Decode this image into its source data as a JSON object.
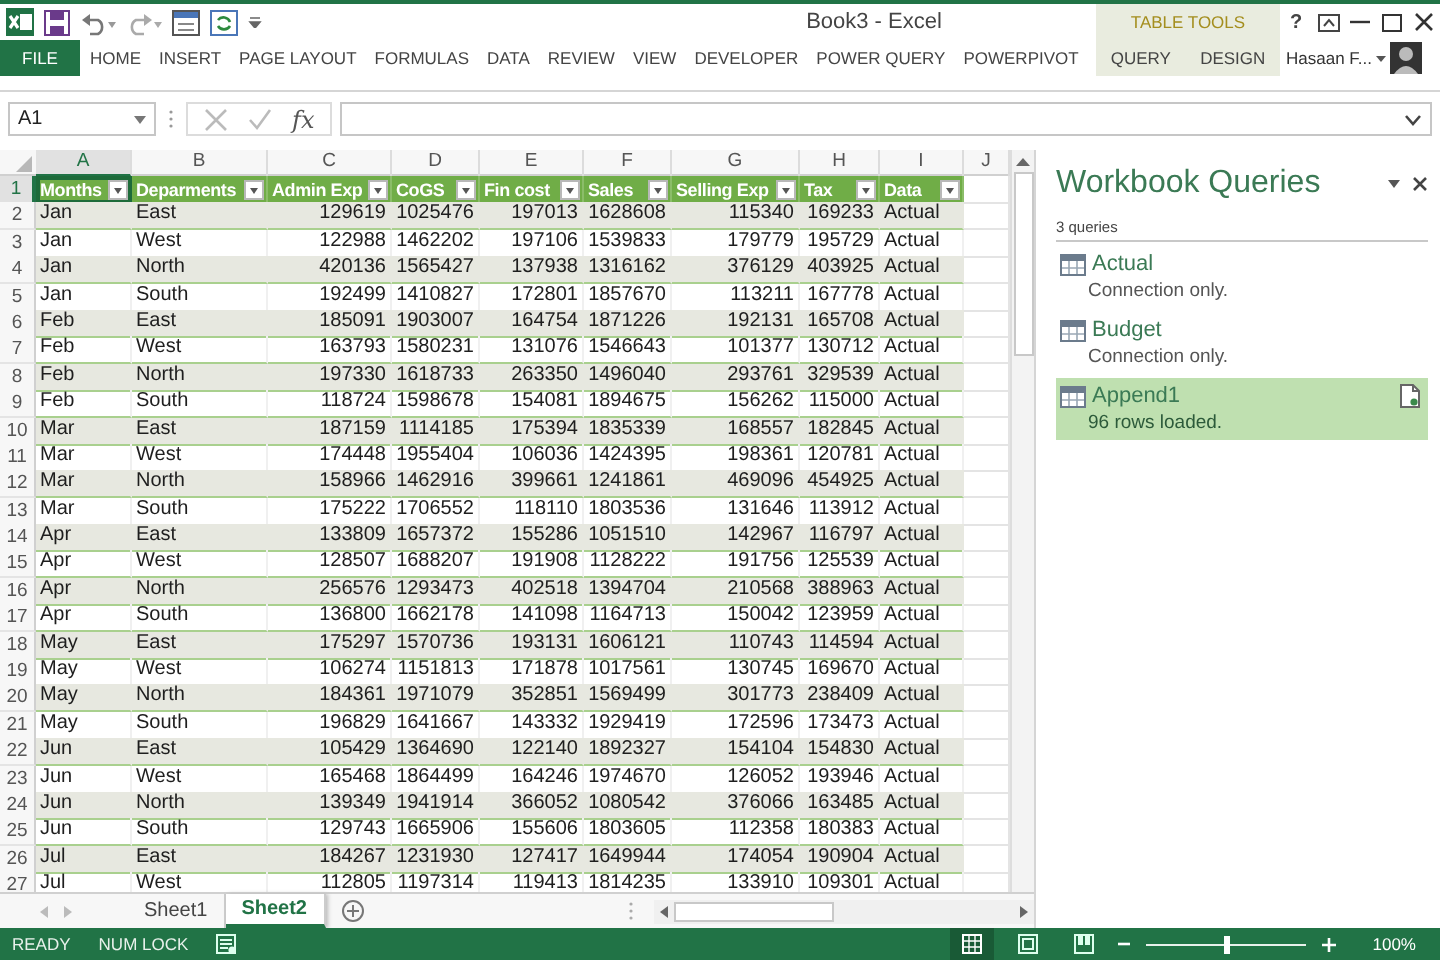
{
  "window": {
    "title": "Book3 - Excel",
    "help": "?"
  },
  "ribbon": {
    "contextual_group": "TABLE TOOLS",
    "user": "Hasaan F...",
    "tabs": [
      {
        "label": "FILE",
        "kind": "file",
        "selected": false
      },
      {
        "label": "HOME",
        "kind": "main",
        "selected": false
      },
      {
        "label": "INSERT",
        "kind": "main",
        "selected": false
      },
      {
        "label": "PAGE LAYOUT",
        "kind": "main",
        "selected": false
      },
      {
        "label": "FORMULAS",
        "kind": "main",
        "selected": false
      },
      {
        "label": "DATA",
        "kind": "main",
        "selected": false
      },
      {
        "label": "REVIEW",
        "kind": "main",
        "selected": false
      },
      {
        "label": "VIEW",
        "kind": "main",
        "selected": false
      },
      {
        "label": "DEVELOPER",
        "kind": "main",
        "selected": false
      },
      {
        "label": "POWER QUERY",
        "kind": "main",
        "selected": false
      },
      {
        "label": "POWERPIVOT",
        "kind": "main",
        "selected": false
      },
      {
        "label": "QUERY",
        "kind": "contextual",
        "selected": false
      },
      {
        "label": "DESIGN",
        "kind": "contextual",
        "selected": false
      }
    ]
  },
  "formula_bar": {
    "name_box": "A1",
    "function_label": "fx"
  },
  "sheet": {
    "columns": [
      {
        "letter": "A",
        "kind": "text",
        "selected": true
      },
      {
        "letter": "B",
        "kind": "text",
        "selected": false
      },
      {
        "letter": "C",
        "kind": "number",
        "selected": false
      },
      {
        "letter": "D",
        "kind": "number",
        "selected": false
      },
      {
        "letter": "E",
        "kind": "number",
        "selected": false
      },
      {
        "letter": "F",
        "kind": "number",
        "selected": false
      },
      {
        "letter": "G",
        "kind": "number",
        "selected": false
      },
      {
        "letter": "H",
        "kind": "number",
        "selected": false
      },
      {
        "letter": "I",
        "kind": "text",
        "selected": false
      },
      {
        "letter": "J",
        "selected": false
      }
    ],
    "header_row": {
      "row_number": "1",
      "selected": true,
      "cells": [
        "Months",
        "Deparments",
        "Admin Exp",
        "CoGS",
        "Fin cost",
        "Sales",
        "Selling Exp",
        "Tax",
        "Data"
      ]
    },
    "rows": [
      {
        "row_number": "2",
        "selected": false,
        "cells": [
          "Jan",
          "East",
          "129619",
          "1025476",
          "197013",
          "1628608",
          "115340",
          "169233",
          "Actual"
        ]
      },
      {
        "row_number": "3",
        "selected": false,
        "cells": [
          "Jan",
          "West",
          "122988",
          "1462202",
          "197106",
          "1539833",
          "179779",
          "195729",
          "Actual"
        ]
      },
      {
        "row_number": "4",
        "selected": false,
        "cells": [
          "Jan",
          "North",
          "420136",
          "1565427",
          "137938",
          "1316162",
          "376129",
          "403925",
          "Actual"
        ]
      },
      {
        "row_number": "5",
        "selected": false,
        "cells": [
          "Jan",
          "South",
          "192499",
          "1410827",
          "172801",
          "1857670",
          "113211",
          "167778",
          "Actual"
        ]
      },
      {
        "row_number": "6",
        "selected": false,
        "cells": [
          "Feb",
          "East",
          "185091",
          "1903007",
          "164754",
          "1871226",
          "192131",
          "165708",
          "Actual"
        ]
      },
      {
        "row_number": "7",
        "selected": false,
        "cells": [
          "Feb",
          "West",
          "163793",
          "1580231",
          "131076",
          "1546643",
          "101377",
          "130712",
          "Actual"
        ]
      },
      {
        "row_number": "8",
        "selected": false,
        "cells": [
          "Feb",
          "North",
          "197330",
          "1618733",
          "263350",
          "1496040",
          "293761",
          "329539",
          "Actual"
        ]
      },
      {
        "row_number": "9",
        "selected": false,
        "cells": [
          "Feb",
          "South",
          "118724",
          "1598678",
          "154081",
          "1894675",
          "156262",
          "115000",
          "Actual"
        ]
      },
      {
        "row_number": "10",
        "selected": false,
        "cells": [
          "Mar",
          "East",
          "187159",
          "1114185",
          "175394",
          "1835339",
          "168557",
          "182845",
          "Actual"
        ]
      },
      {
        "row_number": "11",
        "selected": false,
        "cells": [
          "Mar",
          "West",
          "174448",
          "1955404",
          "106036",
          "1424395",
          "198361",
          "120781",
          "Actual"
        ]
      },
      {
        "row_number": "12",
        "selected": false,
        "cells": [
          "Mar",
          "North",
          "158966",
          "1462916",
          "399661",
          "1241861",
          "469096",
          "454925",
          "Actual"
        ]
      },
      {
        "row_number": "13",
        "selected": false,
        "cells": [
          "Mar",
          "South",
          "175222",
          "1706552",
          "118110",
          "1803536",
          "131646",
          "113912",
          "Actual"
        ]
      },
      {
        "row_number": "14",
        "selected": false,
        "cells": [
          "Apr",
          "East",
          "133809",
          "1657372",
          "155286",
          "1051510",
          "142967",
          "116797",
          "Actual"
        ]
      },
      {
        "row_number": "15",
        "selected": false,
        "cells": [
          "Apr",
          "West",
          "128507",
          "1688207",
          "191908",
          "1128222",
          "191756",
          "125539",
          "Actual"
        ]
      },
      {
        "row_number": "16",
        "selected": false,
        "cells": [
          "Apr",
          "North",
          "256576",
          "1293473",
          "402518",
          "1394704",
          "210568",
          "388963",
          "Actual"
        ]
      },
      {
        "row_number": "17",
        "selected": false,
        "cells": [
          "Apr",
          "South",
          "136800",
          "1662178",
          "141098",
          "1164713",
          "150042",
          "123959",
          "Actual"
        ]
      },
      {
        "row_number": "18",
        "selected": false,
        "cells": [
          "May",
          "East",
          "175297",
          "1570736",
          "193131",
          "1606121",
          "110743",
          "114594",
          "Actual"
        ]
      },
      {
        "row_number": "19",
        "selected": false,
        "cells": [
          "May",
          "West",
          "106274",
          "1151813",
          "171878",
          "1017561",
          "130745",
          "169670",
          "Actual"
        ]
      },
      {
        "row_number": "20",
        "selected": false,
        "cells": [
          "May",
          "North",
          "184361",
          "1971079",
          "352851",
          "1569499",
          "301773",
          "238409",
          "Actual"
        ]
      },
      {
        "row_number": "21",
        "selected": false,
        "cells": [
          "May",
          "South",
          "196829",
          "1641667",
          "143332",
          "1929419",
          "172596",
          "173473",
          "Actual"
        ]
      },
      {
        "row_number": "22",
        "selected": false,
        "cells": [
          "Jun",
          "East",
          "105429",
          "1364690",
          "122140",
          "1892327",
          "154104",
          "154830",
          "Actual"
        ]
      },
      {
        "row_number": "23",
        "selected": false,
        "cells": [
          "Jun",
          "West",
          "165468",
          "1864499",
          "164246",
          "1974670",
          "126052",
          "193946",
          "Actual"
        ]
      },
      {
        "row_number": "24",
        "selected": false,
        "cells": [
          "Jun",
          "North",
          "139349",
          "1941914",
          "366052",
          "1080542",
          "376066",
          "163485",
          "Actual"
        ]
      },
      {
        "row_number": "25",
        "selected": false,
        "cells": [
          "Jun",
          "South",
          "129743",
          "1665906",
          "155606",
          "1803605",
          "112358",
          "180383",
          "Actual"
        ]
      },
      {
        "row_number": "26",
        "selected": false,
        "cells": [
          "Jul",
          "East",
          "184267",
          "1231930",
          "127417",
          "1649944",
          "174054",
          "190904",
          "Actual"
        ]
      },
      {
        "row_number": "27",
        "selected": false,
        "cells": [
          "Jul",
          "West",
          "112805",
          "1197314",
          "119413",
          "1814235",
          "133910",
          "109301",
          "Actual"
        ]
      }
    ]
  },
  "queries_pane": {
    "title": "Workbook Queries",
    "count": "3 queries",
    "items": [
      {
        "name": "Actual",
        "status": "Connection only.",
        "selected": false
      },
      {
        "name": "Budget",
        "status": "Connection only.",
        "selected": false
      },
      {
        "name": "Append1",
        "status": "96 rows loaded.",
        "selected": true
      }
    ]
  },
  "sheet_tabs": [
    {
      "label": "Sheet1",
      "selected": false
    },
    {
      "label": "Sheet2",
      "selected": true
    }
  ],
  "status_bar": {
    "items": [
      "READY",
      "NUM LOCK"
    ],
    "zoom": "100%",
    "zoom_slider": {
      "level": 0.5
    }
  }
}
